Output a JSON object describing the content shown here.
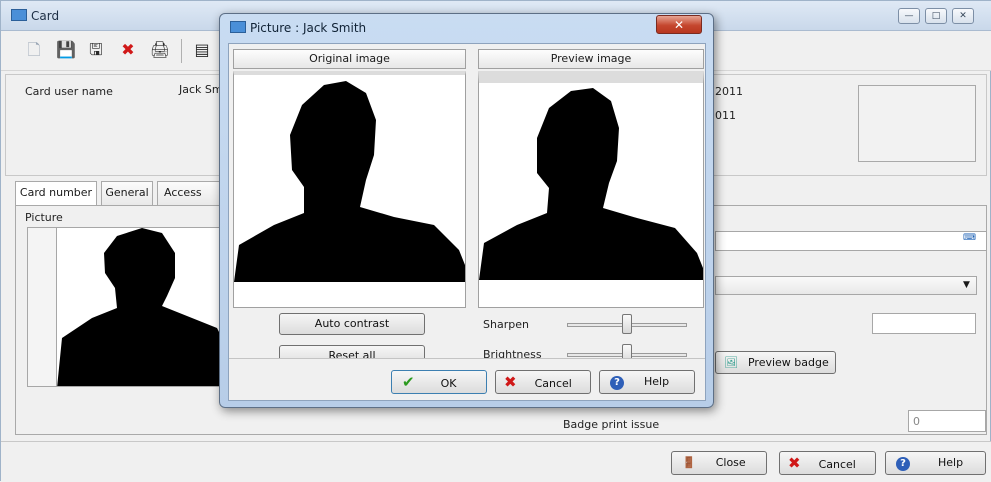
{
  "window": {
    "title": "Card",
    "controls": [
      "minimize",
      "maximize",
      "close"
    ]
  },
  "toolbar": {
    "icons": [
      "new-icon",
      "save-icon",
      "save-as-icon",
      "delete-icon",
      "print-icon",
      "list-icon"
    ]
  },
  "card": {
    "user_name_label": "Card user name",
    "user_name_value": "Jack Sm",
    "date1": "2011",
    "date2": "011"
  },
  "tabs": [
    "Card number",
    "General",
    "Access leve"
  ],
  "picture_label": "Picture",
  "right_panel": {
    "preview_badge": "Preview badge",
    "badge_print_issue_label": "Badge print issue",
    "badge_print_issue_value": "0"
  },
  "footer": {
    "close": "Close",
    "cancel": "Cancel",
    "help": "Help"
  },
  "dialog": {
    "title": "Picture : Jack Smith",
    "original_image_header": "Original image",
    "preview_image_header": "Preview image",
    "auto_contrast": "Auto contrast",
    "reset_all": "Reset all",
    "sharpen_label": "Sharpen",
    "brightness_label": "Brightness",
    "sharpen_level": 0.5,
    "brightness_level": 0.5,
    "ok": "OK",
    "cancel": "Cancel",
    "help": "Help"
  }
}
